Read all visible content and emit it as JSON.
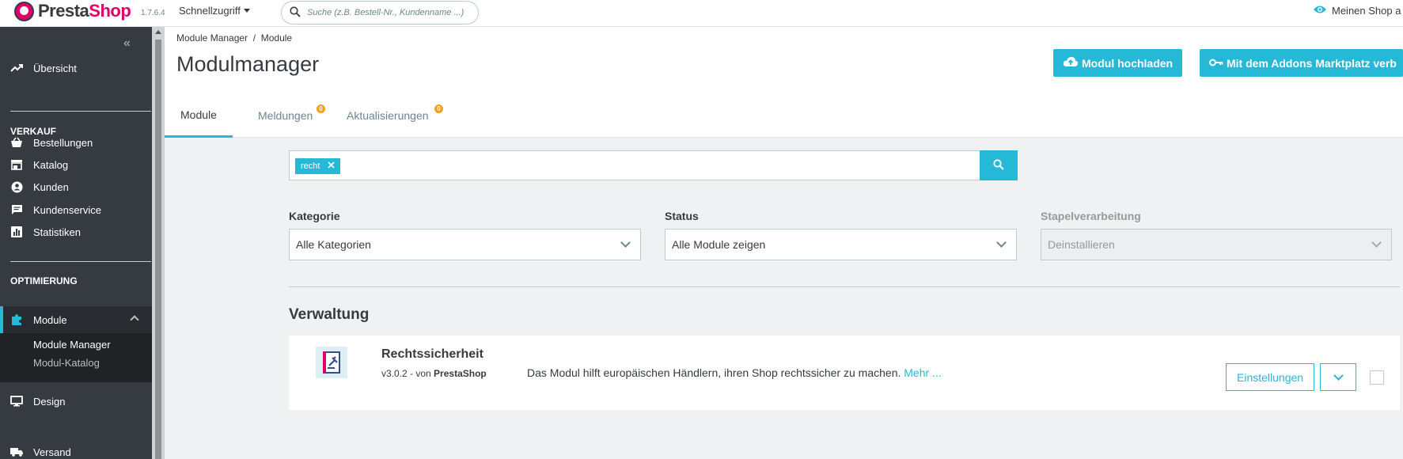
{
  "header": {
    "logo_text_1": "Presta",
    "logo_text_2": "Shop",
    "version": "1.7.6.4",
    "quick_access": "Schnellzugriff",
    "search_placeholder": "Suche (z.B. Bestell-Nr., Kundenname ...)",
    "my_shop": "Meinen Shop a"
  },
  "sidebar": {
    "overview": "Übersicht",
    "sales_heading": "VERKAUF",
    "sales_items": [
      "Bestellungen",
      "Katalog",
      "Kunden",
      "Kundenservice",
      "Statistiken"
    ],
    "optimize_heading": "OPTIMIERUNG",
    "active_item": "Module",
    "sub_items": [
      "Module Manager",
      "Modul-Katalog"
    ],
    "after_items": [
      "Design",
      "Versand"
    ]
  },
  "page": {
    "breadcrumb": "Module Manager  /  Module",
    "title": "Modulmanager",
    "upload_button": "Modul hochladen",
    "addons_button": "Mit dem Addons Marktplatz verb"
  },
  "tabs": [
    {
      "label": "Module",
      "active": true
    },
    {
      "label": "Meldungen",
      "badge": "0"
    },
    {
      "label": "Aktualisierungen",
      "badge": "0"
    }
  ],
  "filter": {
    "tag": "recht",
    "category_label": "Kategorie",
    "category_value": "Alle Kategorien",
    "status_label": "Status",
    "status_value": "Alle Module zeigen",
    "bulk_label": "Stapelverarbeitung",
    "bulk_value": "Deinstallieren"
  },
  "section": {
    "title": "Verwaltung"
  },
  "module": {
    "name": "Rechtssicherheit",
    "version_prefix": "v3.0.2 - von ",
    "author": "PrestaShop",
    "description": "Das Modul hilft europäischen Händlern, ihren Shop rechtssicher zu machen.",
    "more": "Mehr ...",
    "settings_button": "Einstellungen"
  },
  "colors": {
    "accent": "#25b9d7",
    "sidebar_bg": "#363a41",
    "brand_pink": "#df0067",
    "badge": "#f9a01b"
  }
}
